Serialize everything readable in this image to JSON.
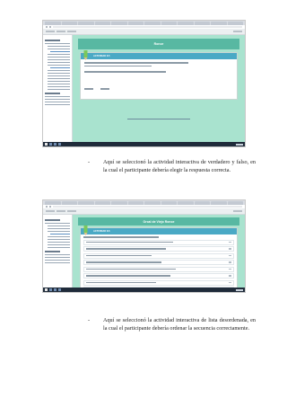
{
  "screenshot1": {
    "banner_title": "Ronce",
    "card_title": "ACTIVIDAD 8.5"
  },
  "screenshot2": {
    "banner_title": "Orcal de Viejo Ronce",
    "card_title": "ACTIVIDAD 8.6"
  },
  "captions": [
    {
      "bullet": "-",
      "text": "Aquí se seleccionó la actividad interactiva de verdadero y falso, en la cual el participante debería elegir la respuesta correcta."
    },
    {
      "bullet": "-",
      "text": "Aquí se seleccionó la actividad interactiva de lista desordenada, en la cual el participante debería ordenar la secuencia correctamente."
    }
  ],
  "colors": {
    "page_background": "#a9e3cf",
    "banner": "#58b8a2",
    "card_header": "#4aa9c5",
    "taskbar": "#1f2b3a"
  },
  "icons": [
    "pencil-icon"
  ]
}
